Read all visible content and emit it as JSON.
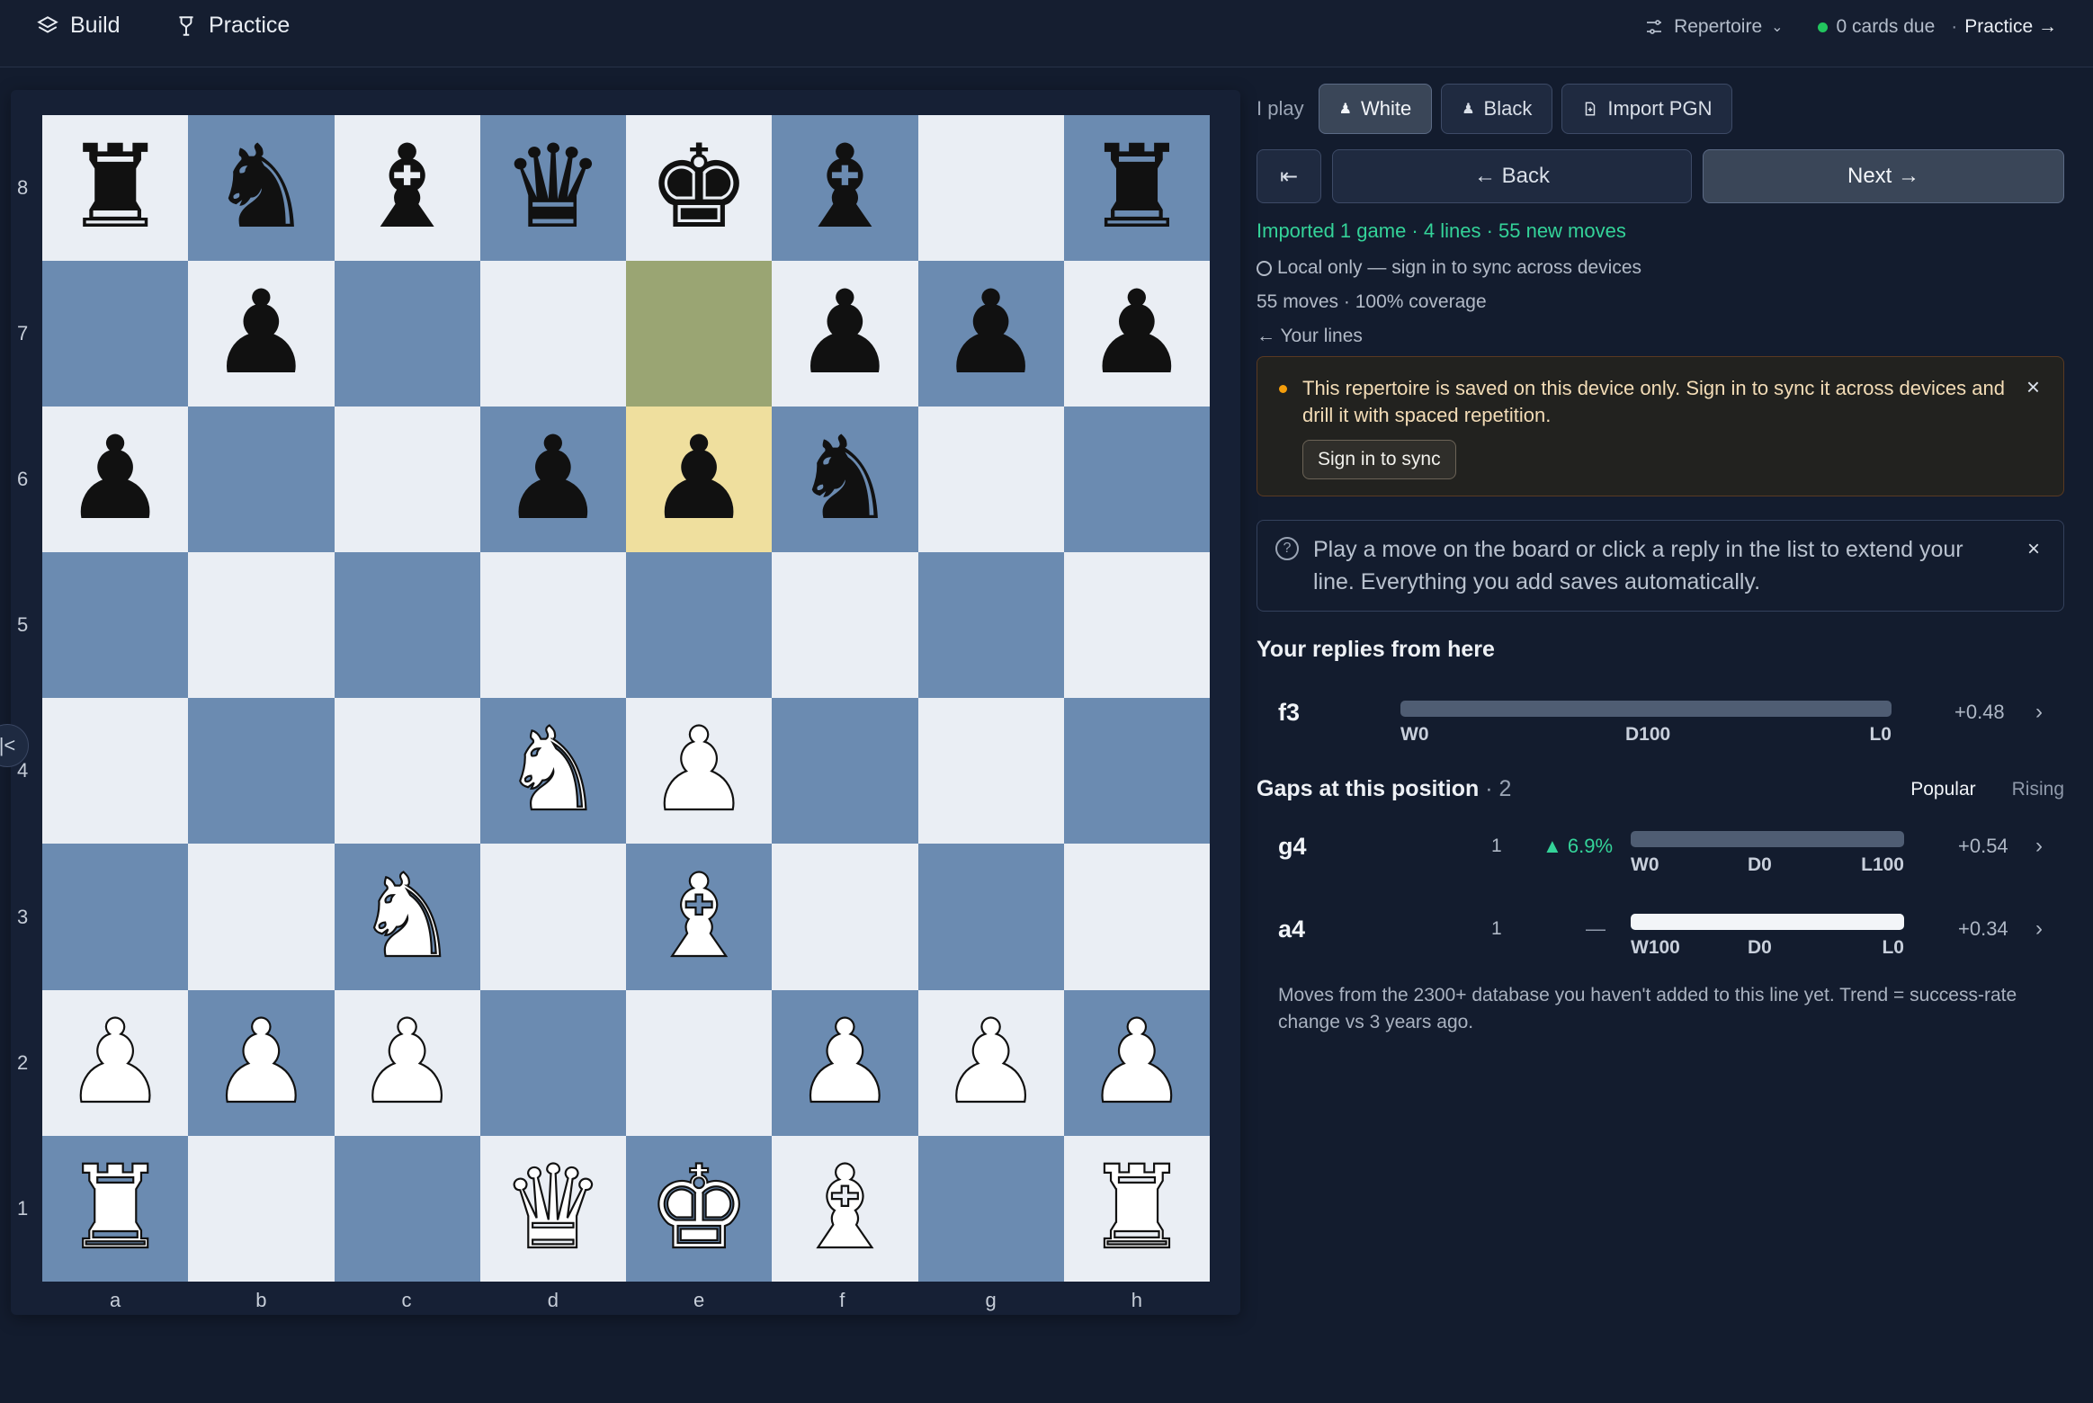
{
  "topbar": {
    "build_label": "Build",
    "practice_label": "Practice",
    "repertoire_label": "Repertoire",
    "cards_due": "0 cards due",
    "practice_link": "Practice →",
    "sep": "·"
  },
  "board": {
    "orientation": "white",
    "files": [
      "a",
      "b",
      "c",
      "d",
      "e",
      "f",
      "g",
      "h"
    ],
    "ranks": [
      "8",
      "7",
      "6",
      "5",
      "4",
      "3",
      "2",
      "1"
    ],
    "position": [
      [
        "bR",
        "bN",
        "bB",
        "bQ",
        "bK",
        "bB",
        "",
        "bR"
      ],
      [
        "",
        "bP",
        "",
        "",
        "",
        "bP",
        "bP",
        "bP"
      ],
      [
        "bP",
        "",
        "",
        "bP",
        "bP",
        "bN",
        "",
        ""
      ],
      [
        "",
        "",
        "",
        "",
        "",
        "",
        "",
        ""
      ],
      [
        "",
        "",
        "",
        "wN",
        "wP",
        "",
        "",
        ""
      ],
      [
        "",
        "",
        "wN",
        "",
        "wB",
        "",
        "",
        ""
      ],
      [
        "wP",
        "wP",
        "wP",
        "",
        "",
        "wP",
        "wP",
        "wP"
      ],
      [
        "wR",
        "",
        "",
        "wQ",
        "wK",
        "wB",
        "",
        "wR"
      ]
    ],
    "last_move": {
      "from": "e7",
      "to": "e6"
    },
    "collapse_icon": "collapse-left-icon"
  },
  "panel": {
    "i_play_label": "I play",
    "white_label": "White",
    "black_label": "Black",
    "import_label": "Import PGN",
    "first_label": "⇤",
    "back_label": "← Back",
    "next_label": "Next →",
    "import_status": "Imported 1 game · 4 lines · 55 new moves",
    "sync_status": "Local only — sign in to sync across devices",
    "coverage": "55 moves · 100% coverage",
    "your_lines": "← Your lines",
    "alert_text": "This repertoire is saved on this device only. Sign in to sync it across devices and drill it with spaced repetition.",
    "alert_button": "Sign in to sync",
    "hint_text": "Play a move on the board or click a reply in the list to extend your line. Everything you add saves automatically.",
    "replies_title": "Your replies from here",
    "replies": [
      {
        "san": "f3",
        "w": "W0",
        "d": "D100",
        "l": "L0",
        "white_win_fraction": 0,
        "eval": "+0.48"
      }
    ],
    "gaps_title": "Gaps at this position",
    "gaps_count": "· 2",
    "tab_popular": "Popular",
    "tab_rising": "Rising",
    "gaps": [
      {
        "san": "g4",
        "count": "1",
        "trend": "▲ 6.9%",
        "trend_dir": "up",
        "w": "W0",
        "d": "D0",
        "l": "L100",
        "white_win_fraction": 0,
        "eval": "+0.54"
      },
      {
        "san": "a4",
        "count": "1",
        "trend": "—",
        "trend_dir": "none",
        "w": "W100",
        "d": "D0",
        "l": "L0",
        "white_win_fraction": 1,
        "eval": "+0.34"
      }
    ],
    "footnote": "Moves from the 2300+ database you haven't added to this line yet. Trend = success-rate change vs 3 years ago.",
    "chevron": "›",
    "close_x": "×"
  }
}
